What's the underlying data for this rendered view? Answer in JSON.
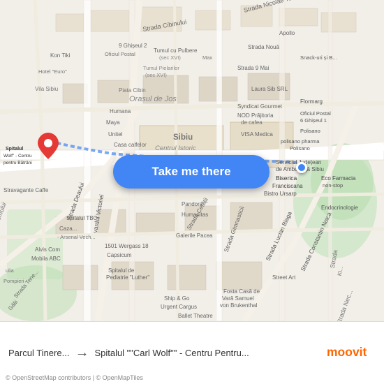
{
  "map": {
    "backgroundColor": "#f2efe9",
    "button_label": "Take me there",
    "copyright": "© OpenStreetMap contributors | © OpenMapTiles"
  },
  "bottom_bar": {
    "origin": "Parcul Tinere...",
    "arrow": "→",
    "destination": "Spitalul \"\"Carl Wolf\"\" - Centru Pentru...",
    "logo": "moovit"
  },
  "icons": {
    "pin": "📍",
    "arrow": "→"
  }
}
